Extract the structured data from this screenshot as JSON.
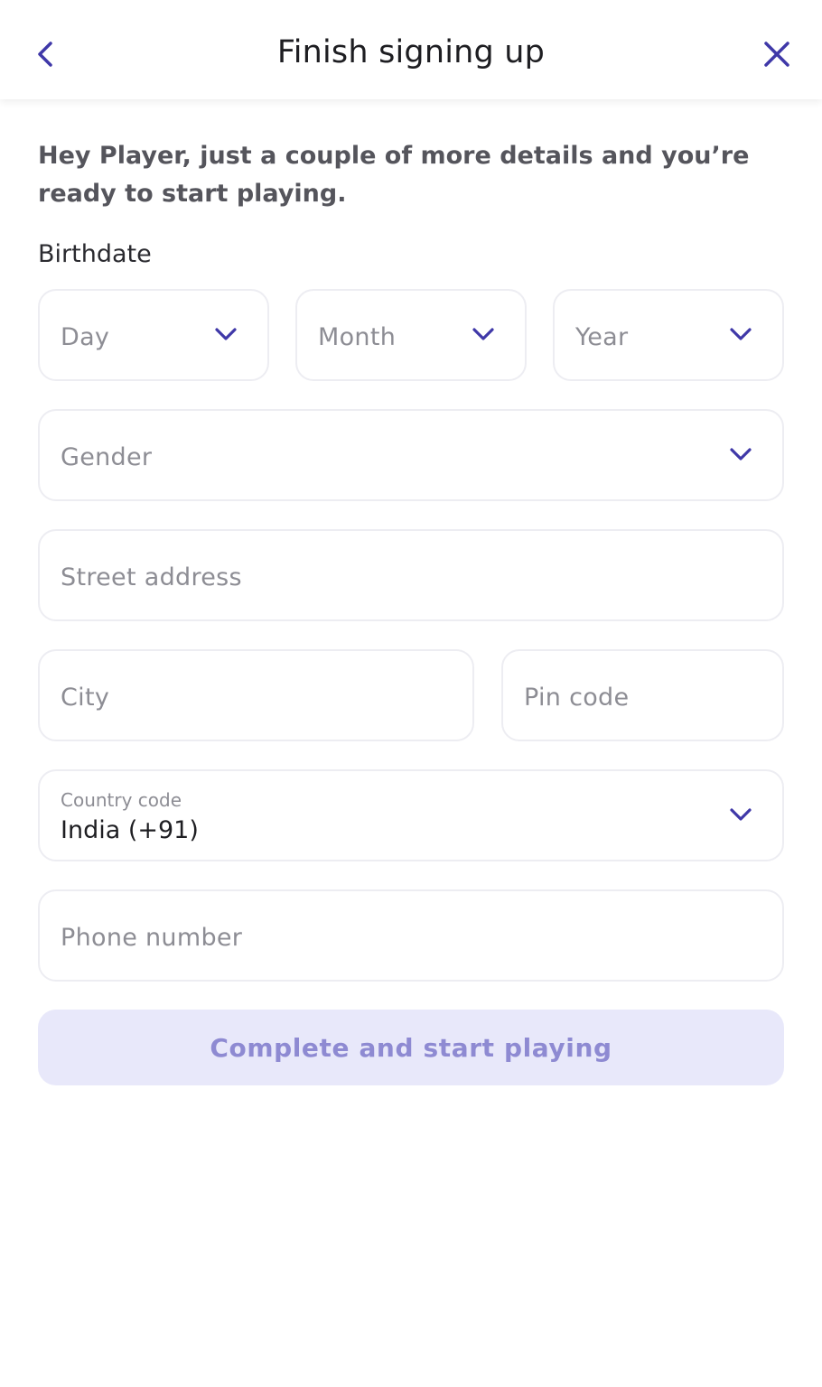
{
  "header": {
    "title": "Finish signing up",
    "back_icon": "chevron-left-icon",
    "close_icon": "close-icon"
  },
  "intro": "Hey Player, just a couple of more details and you’re ready to start playing.",
  "birthdate": {
    "label": "Birthdate",
    "day_placeholder": "Day",
    "month_placeholder": "Month",
    "year_placeholder": "Year"
  },
  "gender": {
    "placeholder": "Gender"
  },
  "street": {
    "placeholder": "Street address"
  },
  "city": {
    "placeholder": "City"
  },
  "pin": {
    "placeholder": "Pin code"
  },
  "country": {
    "label": "Country code",
    "value": "India (+91)"
  },
  "phone": {
    "placeholder": "Phone number"
  },
  "submit_label": "Complete and start playing",
  "colors": {
    "accent": "#3f38a8",
    "button_bg": "#e8e8fa",
    "button_text": "#8e8ad2",
    "border": "#ededf2"
  }
}
